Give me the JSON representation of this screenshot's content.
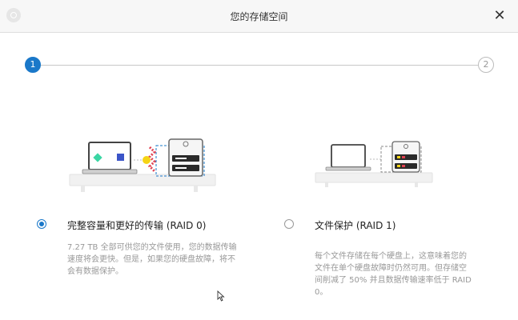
{
  "window": {
    "title": "您的存储空间",
    "close_glyph": "✕"
  },
  "stepper": {
    "steps": [
      {
        "label": "1",
        "state": "active"
      },
      {
        "label": "2",
        "state": "inactive"
      }
    ]
  },
  "options": [
    {
      "id": "raid0",
      "title": "完整容量和更好的传输 (RAID 0)",
      "selected": true,
      "description_lines": [
        "7.27 TB 全部可供您的文件使用，您的数据传输",
        "速度将会更快。但是，如果您的硬盘故障，将不",
        "会有数据保护。"
      ]
    },
    {
      "id": "raid1",
      "title": "文件保护 (RAID 1)",
      "selected": false,
      "description_lines": [
        "每个文件存储在每个硬盘上，这意味着您的",
        "文件在单个硬盘故障时仍然可用。但存储空",
        "间削减了 50% 并且数据传输速率低于 RAID",
        "0。"
      ]
    }
  ],
  "colors": {
    "accent": "#1a78c9",
    "titlebar_bg": "#f7f7f7"
  },
  "icons": {
    "app": "app-icon",
    "close": "close-icon",
    "cursor": "mouse-pointer-icon"
  }
}
